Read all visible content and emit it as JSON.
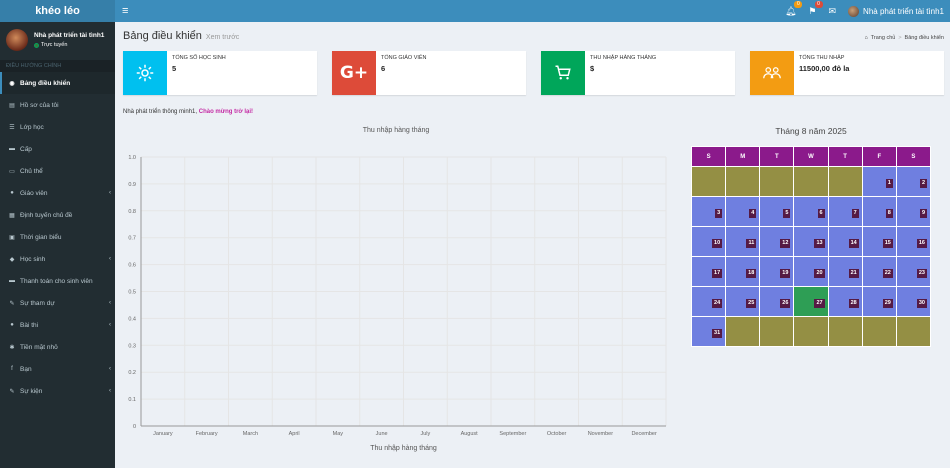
{
  "app": {
    "logo": "khéo léo"
  },
  "topbar": {
    "menu_icon": "hamburger-icon",
    "bell_count": "0",
    "flag_count": "0",
    "user_name": "Nhà phát triển tài tình1",
    "colors": {
      "bell_badge": "#f39c12",
      "flag_badge": "#dd4b39"
    }
  },
  "sidebar": {
    "user_name": "Nhà phát triển tài tình1",
    "status": "Trực tuyến",
    "header": "ĐIỀU HƯỚNG CHÍNH",
    "items": [
      {
        "label": "Bảng điều khiển",
        "icon": "dashboard-icon",
        "glyph": "◉",
        "arrow": false
      },
      {
        "label": "Hồ sơ của tôi",
        "icon": "id-card-icon",
        "glyph": "▤",
        "arrow": false
      },
      {
        "label": "Lớp học",
        "icon": "list-icon",
        "glyph": "☰",
        "arrow": false
      },
      {
        "label": "Cấp",
        "icon": "level-icon",
        "glyph": "▬",
        "arrow": false
      },
      {
        "label": "Chủ thể",
        "icon": "subject-icon",
        "glyph": "▭",
        "arrow": false
      },
      {
        "label": "Giáo viên",
        "icon": "teacher-icon",
        "glyph": "●",
        "arrow": true
      },
      {
        "label": "Định tuyến chủ đề",
        "icon": "routing-icon",
        "glyph": "▦",
        "arrow": false
      },
      {
        "label": "Thời gian biểu",
        "icon": "calendar-icon",
        "glyph": "▣",
        "arrow": false
      },
      {
        "label": "Học sinh",
        "icon": "students-icon",
        "glyph": "◆",
        "arrow": true
      },
      {
        "label": "Thanh toán cho sinh viên",
        "icon": "payment-icon",
        "glyph": "▬",
        "arrow": false
      },
      {
        "label": "Sự tham dự",
        "icon": "attendance-icon",
        "glyph": "✎",
        "arrow": true
      },
      {
        "label": "Bài thi",
        "icon": "exam-icon",
        "glyph": "●",
        "arrow": true
      },
      {
        "label": "Tiền mặt nhỏ",
        "icon": "cash-icon",
        "glyph": "✱",
        "arrow": false
      },
      {
        "label": "Bạn",
        "icon": "facebook-icon",
        "glyph": "f",
        "arrow": true
      },
      {
        "label": "Sự kiện",
        "icon": "event-icon",
        "glyph": "✎",
        "arrow": true
      }
    ]
  },
  "header": {
    "title": "Bảng điều khiển",
    "subtitle": "Xem trước",
    "breadcrumb": [
      "Trang chủ",
      "Bảng điều khiển"
    ]
  },
  "info_boxes": [
    {
      "label": "TỔNG SỐ HỌC SINH",
      "value": "5",
      "icon": "gear-icon",
      "color": "#00c0ef"
    },
    {
      "label": "TỔNG GIÁO VIÊN",
      "value": "6",
      "icon": "google-plus-icon",
      "color": "#dd4b39"
    },
    {
      "label": "THU NHẬP HÀNG THÁNG",
      "value": "$",
      "icon": "cart-icon",
      "color": "#00a65a"
    },
    {
      "label": "TỔNG THU NHẬP",
      "value": "11500,00 đô la",
      "icon": "users-icon",
      "color": "#f39c12"
    }
  ],
  "welcome": {
    "prefix": "Nhà phát triển thông minh1,",
    "highlight": "Chào mừng trở lại!"
  },
  "chart_data": {
    "type": "line",
    "title": "Thu nhập hàng tháng",
    "categories": [
      "January",
      "February",
      "March",
      "April",
      "May",
      "June",
      "July",
      "August",
      "September",
      "October",
      "November",
      "December"
    ],
    "series": [],
    "ylim": [
      0,
      1
    ],
    "yticks": [
      "0",
      "0.1",
      "0.2",
      "0.3",
      "0.4",
      "0.5",
      "0.6",
      "0.7",
      "0.8",
      "0.9",
      "1.0"
    ],
    "xlabel": "Thu nhập hàng tháng",
    "grid": true
  },
  "calendar": {
    "title": "Tháng 8 năm 2025",
    "weekdays": [
      "S",
      "M",
      "T",
      "W",
      "T",
      "F",
      "S"
    ],
    "weeks": [
      [
        null,
        null,
        null,
        null,
        null,
        1,
        2
      ],
      [
        3,
        4,
        5,
        6,
        7,
        8,
        9
      ],
      [
        10,
        11,
        12,
        13,
        14,
        15,
        16
      ],
      [
        17,
        18,
        19,
        20,
        21,
        22,
        23
      ],
      [
        24,
        25,
        26,
        27,
        28,
        29,
        30
      ],
      [
        31,
        null,
        null,
        null,
        null,
        null,
        null
      ]
    ],
    "today": 27,
    "colors": {
      "header": "#8b1a8b",
      "current": "#6f7fe0",
      "other": "#948f44",
      "today": "#2e9e55"
    }
  }
}
